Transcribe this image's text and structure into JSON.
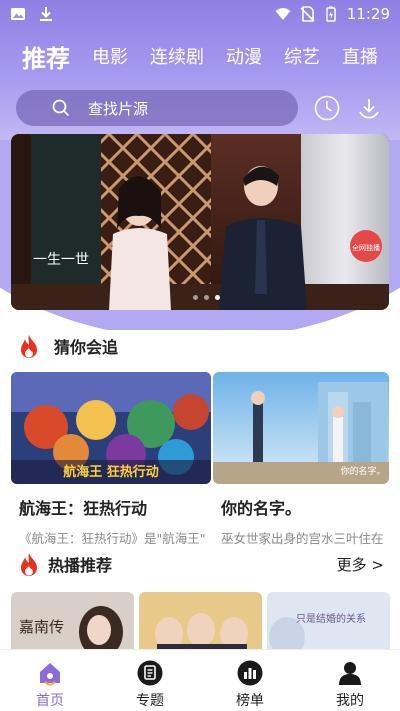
{
  "status_bar": {
    "time": "11:29"
  },
  "top_tabs": [
    "推荐",
    "电影",
    "连续剧",
    "动漫",
    "综艺",
    "直播"
  ],
  "search": {
    "placeholder": "查找片源"
  },
  "banner": {
    "caption": "一生一世",
    "badge": "全网独播"
  },
  "section_guess": {
    "title": "猜你会追"
  },
  "cards": [
    {
      "title": "航海王：狂热行动",
      "desc": "《航海王：狂热行动》是\"航海王\"系列",
      "poster_text": "航海王 狂热行动"
    },
    {
      "title": "你的名字。",
      "desc": "巫女世家出身的宫水三叶住在",
      "poster_text": "你的名字。"
    }
  ],
  "section_hot": {
    "title": "热播推荐",
    "more": "更多 >"
  },
  "hot_thumbs": [
    {
      "title": "嘉南传"
    },
    {
      "title": ""
    },
    {
      "title": "只是结婚的关系"
    }
  ],
  "bottom_nav": [
    {
      "label": "首页",
      "active": true
    },
    {
      "label": "专题",
      "active": false
    },
    {
      "label": "榜单",
      "active": false
    },
    {
      "label": "我的",
      "active": false
    }
  ],
  "colors": {
    "accent": "#8b6dd9",
    "header": "#9d8fe8"
  }
}
